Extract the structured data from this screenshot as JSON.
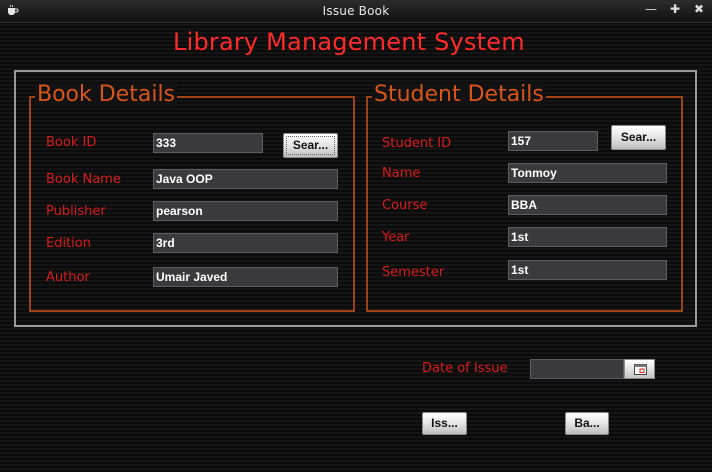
{
  "window": {
    "title": "Issue Book",
    "controls": {
      "minimize": "—",
      "maximize": "✚",
      "close": "✖"
    }
  },
  "app": {
    "heading": "Library Management System"
  },
  "book_details": {
    "title": "Book Details",
    "book_id_label": "Book ID",
    "book_id_value": "333",
    "search_button": "Sear...",
    "book_name_label": "Book Name",
    "book_name_value": "Java OOP",
    "publisher_label": "Publisher",
    "publisher_value": "pearson",
    "edition_label": "Edition",
    "edition_value": "3rd",
    "author_label": "Author",
    "author_value": "Umair Javed"
  },
  "student_details": {
    "title": "Student Details",
    "student_id_label": "Student ID",
    "student_id_value": "157",
    "search_button": "Sear...",
    "name_label": "Name",
    "name_value": "Tonmoy",
    "course_label": "Course",
    "course_value": "BBA",
    "year_label": "Year",
    "year_value": "1st",
    "semester_label": "Semester",
    "semester_value": "1st"
  },
  "issue": {
    "date_label": "Date of Issue",
    "date_value": "",
    "issue_button": "Iss...",
    "back_button": "Ba..."
  },
  "icons": {
    "app": "coffee-cup-icon",
    "calendar": "calendar-icon"
  },
  "colors": {
    "label": "#d81c1c",
    "group_border": "#a04416",
    "heading": "#ff2b2b"
  }
}
